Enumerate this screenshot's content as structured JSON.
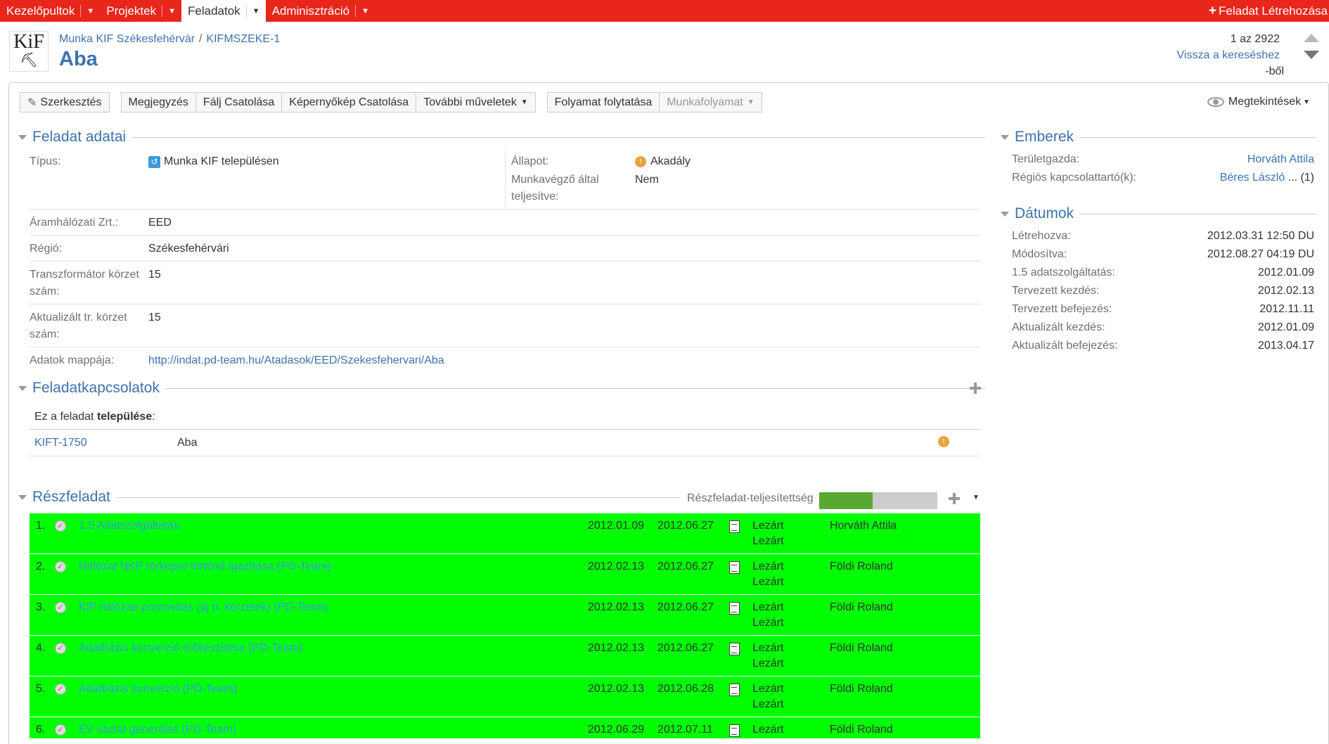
{
  "nav": {
    "items": [
      {
        "label": "Kezelőpultok"
      },
      {
        "label": "Projektek"
      },
      {
        "label": "Feladatok"
      },
      {
        "label": "Adminisztráció"
      }
    ],
    "create_label": "Feladat Létrehozása"
  },
  "header": {
    "logo_text": "KiF",
    "breadcrumb_project": "Munka KIF Székesfehérvár",
    "breadcrumb_sep": "/",
    "breadcrumb_key": "KIFMSZEKE-1",
    "title": "Aba",
    "pager_count": "1 az 2922",
    "pager_back": "Vissza a kereséshez",
    "pager_suffix": "-ből"
  },
  "toolbar": {
    "edit": "Szerkesztés",
    "comment": "Megjegyzés",
    "attach_file": "Fálj Csatolása",
    "attach_screenshot": "Képernyőkép Csatolása",
    "more": "További műveletek",
    "progress": "Folyamat folytatása",
    "workflow": "Munkafolyamat",
    "views": "Megtekintések"
  },
  "details": {
    "heading": "Feladat adatai",
    "type_label": "Típus:",
    "type_value": "Munka KIF településen",
    "status_label": "Állapot:",
    "status_value": "Akadály",
    "done_label_1": "Munkavégző által",
    "done_label_2": "teljesítve:",
    "done_value": "Nem",
    "utility_label": "Áramhálózati Zrt.:",
    "utility_value": "EED",
    "region_label": "Régió:",
    "region_value": "Székesfehérvári",
    "tr_label_1": "Transzformátor körzet",
    "tr_label_2": "szám:",
    "tr_value": "15",
    "atr_label_1": "Aktualizált tr. körzet",
    "atr_label_2": "szám:",
    "atr_value": "15",
    "folder_label": "Adatok mappája:",
    "folder_value": "http://indat.pd-team.hu/Atadasok/EED/Szekesfehervari/Aba"
  },
  "links": {
    "heading": "Feladatkapcsolatok",
    "relation_prefix": "Ez a feladat ",
    "relation_bold": "települése",
    "relation_suffix": ":",
    "key": "KIFT-1750",
    "summary": "Aba"
  },
  "people": {
    "heading": "Emberek",
    "rows": [
      {
        "label": "Területgazda:",
        "value": "Horváth Attila",
        "extra": ""
      },
      {
        "label": "Régiós kapcsolattartó(k):",
        "value": "Béres László",
        "extra": " ... (1)"
      }
    ]
  },
  "dates": {
    "heading": "Dátumok",
    "rows": [
      {
        "label": "Létrehozva:",
        "value": "2012.03.31 12:50 DU"
      },
      {
        "label": "Módosítva:",
        "value": "2012.08.27 04:19 DU"
      },
      {
        "label": "1.5 adatszolgáltatás:",
        "value": "2012.01.09"
      },
      {
        "label": "Tervezett kezdés:",
        "value": "2012.02.13"
      },
      {
        "label": "Tervezett befejezés:",
        "value": "2012.11.11"
      },
      {
        "label": "Aktualizált kezdés:",
        "value": "2012.01.09"
      },
      {
        "label": "Aktualizált befejezés:",
        "value": "2013.04.17"
      }
    ]
  },
  "subtasks": {
    "heading": "Részfeladat",
    "progress_label": "Részfeladat-teljesítettség",
    "progress_fraction": 0.45,
    "progress_done_color": "#5aa82f",
    "progress_rest_color": "#cccccc",
    "row_color": "#00ff00",
    "items": [
      {
        "num": "1.",
        "summary": "1.5 Adatszolgáltatás",
        "start": "2012.01.09",
        "end": "2012.06.27",
        "status1": "Lezárt",
        "status2": "Lezárt",
        "assignee": "Horváth Attila"
      },
      {
        "num": "2.",
        "summary": "Hálózat NKP térképre történő igazítása (PD-Team)",
        "start": "2012.02.13",
        "end": "2012.06.27",
        "status1": "Lezárt",
        "status2": "Lezárt",
        "assignee": "Földi Roland"
      },
      {
        "num": "3.",
        "summary": "KIF hálózati pontosítás (új tr. körzetek) (PD-Team)",
        "start": "2012.02.13",
        "end": "2012.06.27",
        "status1": "Lezárt",
        "status2": "Lezárt",
        "assignee": "Földi Roland"
      },
      {
        "num": "4.",
        "summary": "Adatbázis konverzió előkészítése (PD-Team)",
        "start": "2012.02.13",
        "end": "2012.06.27",
        "status1": "Lezárt",
        "status2": "Lezárt",
        "assignee": "Földi Roland"
      },
      {
        "num": "5.",
        "summary": "Adatbázis konverzió (PD-Team)",
        "start": "2012.02.13",
        "end": "2012.06.28",
        "status1": "Lezárt",
        "status2": "Lezárt",
        "assignee": "Földi Roland"
      },
      {
        "num": "6.",
        "summary": "ÉV vázlat generálás (PD-Team)",
        "start": "2012.06.29",
        "end": "2012.07.11",
        "status1": "Lezárt",
        "status2": "",
        "assignee": "Földi Roland"
      }
    ]
  },
  "colors": {
    "nav_bg": "#e8261c",
    "link": "#3b73af"
  }
}
